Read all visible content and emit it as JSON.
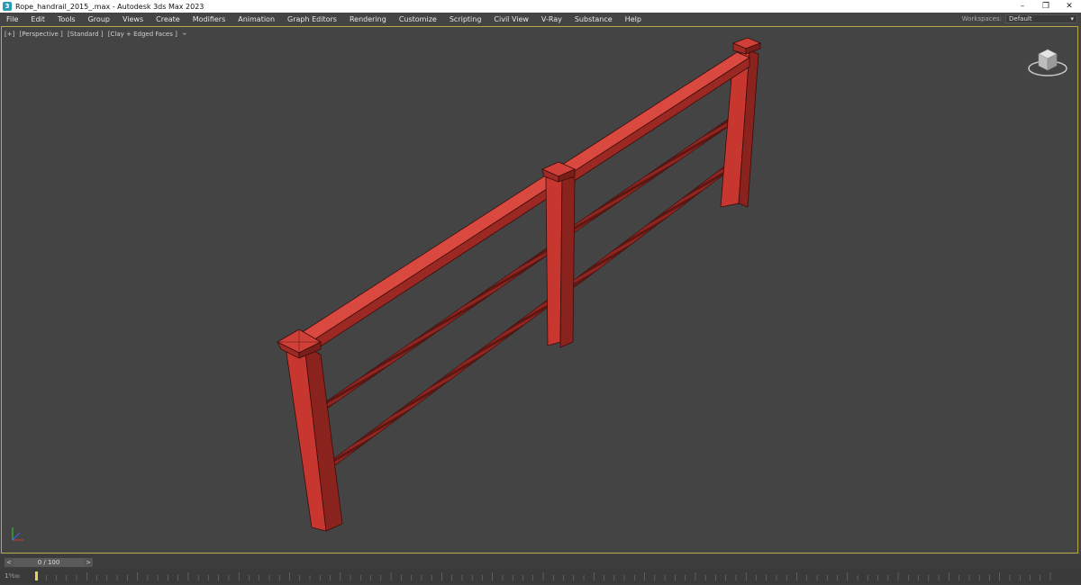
{
  "window": {
    "title": "Rope_handrail_2015_.max - Autodesk 3ds Max 2023",
    "icon": "3",
    "minimize": "–",
    "maximize": "❐",
    "close": "✕"
  },
  "menubar": {
    "items": [
      "File",
      "Edit",
      "Tools",
      "Group",
      "Views",
      "Create",
      "Modifiers",
      "Animation",
      "Graph Editors",
      "Rendering",
      "Customize",
      "Scripting",
      "Civil View",
      "V-Ray",
      "Substance",
      "Help"
    ],
    "workspaces_label": "Workspaces:",
    "workspaces_value": "Default"
  },
  "viewport": {
    "label_plus": "[+]",
    "label_view": "[Perspective ]",
    "label_shading": "[Standard ]",
    "label_style": "[Clay + Edged Faces ]",
    "filter_icon": "funnel-icon",
    "colors": {
      "object": "#b8312a",
      "object_dark": "#7e1f1a",
      "object_light": "#d9493f",
      "background": "#444444",
      "border": "#b8a84a"
    }
  },
  "timeline": {
    "prev": "<",
    "next": ">",
    "slider_text": "0 / 100",
    "frame_counter": "1⁰⁄₁₀₀",
    "current_frame": 0,
    "total_frames": 100
  }
}
